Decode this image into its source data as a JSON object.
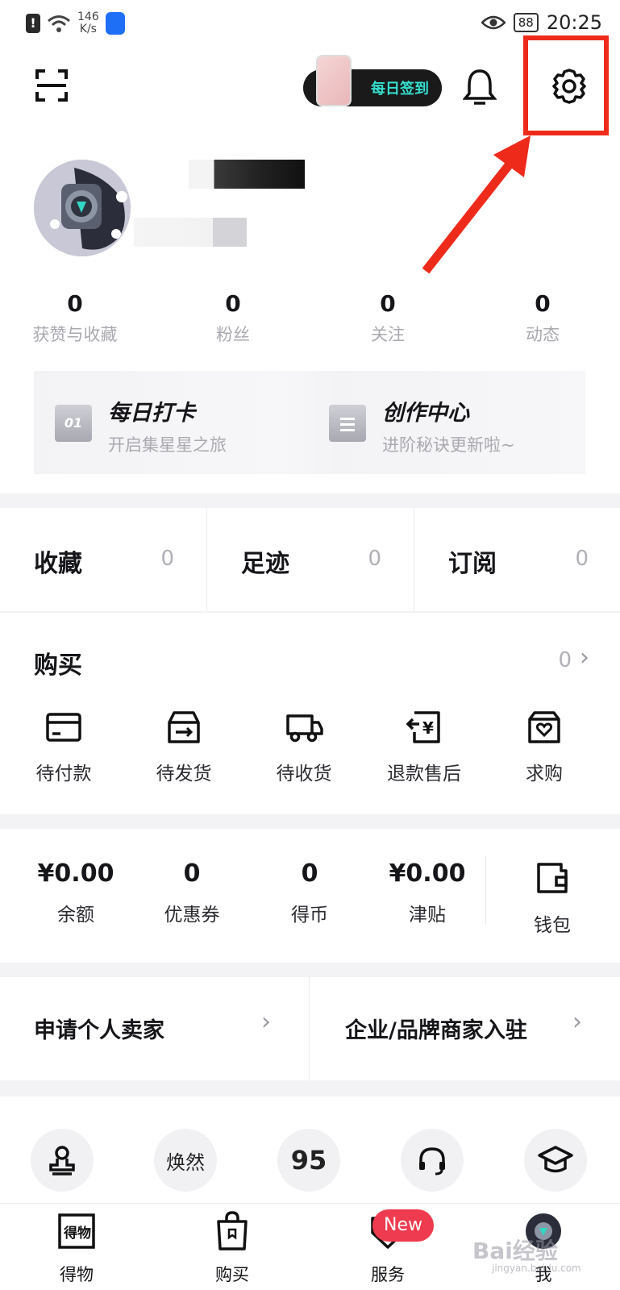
{
  "status_bar": {
    "alert": "!",
    "speed_value": "146",
    "speed_unit": "K/s",
    "battery": "88",
    "time": "20:25"
  },
  "header": {
    "daily_checkin_label": "每日签到"
  },
  "profile": {
    "stats": [
      {
        "value": "0",
        "label": "获赞与收藏"
      },
      {
        "value": "0",
        "label": "粉丝"
      },
      {
        "value": "0",
        "label": "关注"
      },
      {
        "value": "0",
        "label": "动态"
      }
    ]
  },
  "quick_entries": [
    {
      "icon_text": "01",
      "title": "每日打卡",
      "subtitle": "开启集星星之旅"
    },
    {
      "icon_text": "",
      "title": "创作中心",
      "subtitle": "进阶秘诀更新啦~"
    }
  ],
  "collections": [
    {
      "label": "收藏",
      "count": "0"
    },
    {
      "label": "足迹",
      "count": "0"
    },
    {
      "label": "订阅",
      "count": "0"
    }
  ],
  "purchase": {
    "title": "购买",
    "count": "0",
    "items": [
      {
        "label": "待付款",
        "icon": "card-icon"
      },
      {
        "label": "待发货",
        "icon": "box-icon"
      },
      {
        "label": "待收货",
        "icon": "truck-icon"
      },
      {
        "label": "退款售后",
        "icon": "refund-icon"
      },
      {
        "label": "求购",
        "icon": "wishbag-icon"
      }
    ]
  },
  "wallet": {
    "items": [
      {
        "value": "¥0.00",
        "label": "余额"
      },
      {
        "value": "0",
        "label": "优惠券"
      },
      {
        "value": "0",
        "label": "得币"
      },
      {
        "value": "¥0.00",
        "label": "津贴"
      }
    ],
    "wallet_label": "钱包"
  },
  "merchant": {
    "personal_seller": "申请个人卖家",
    "brand_seller": "企业/品牌商家入驻"
  },
  "services": [
    {
      "icon": "stamp-icon",
      "text": ""
    },
    {
      "icon": "huanran-icon",
      "text": "焕然"
    },
    {
      "icon": "95-icon",
      "text": "95"
    },
    {
      "icon": "headset-icon",
      "text": ""
    },
    {
      "icon": "graduation-icon",
      "text": ""
    }
  ],
  "tabbar": {
    "tabs": [
      {
        "label": "得物",
        "icon": "dewu-icon"
      },
      {
        "label": "购买",
        "icon": "shopping-bag-icon"
      },
      {
        "label": "服务",
        "icon": "service-icon"
      },
      {
        "label": "我",
        "icon": "me-avatar-icon"
      }
    ],
    "new_badge": "New"
  },
  "watermark": {
    "text": "Bai经验",
    "sub": "jingyan.baidu.com"
  },
  "colors": {
    "highlight": "#ee2a1b",
    "accent_teal": "#35e0d0",
    "badge_red": "#ef3b4f"
  }
}
